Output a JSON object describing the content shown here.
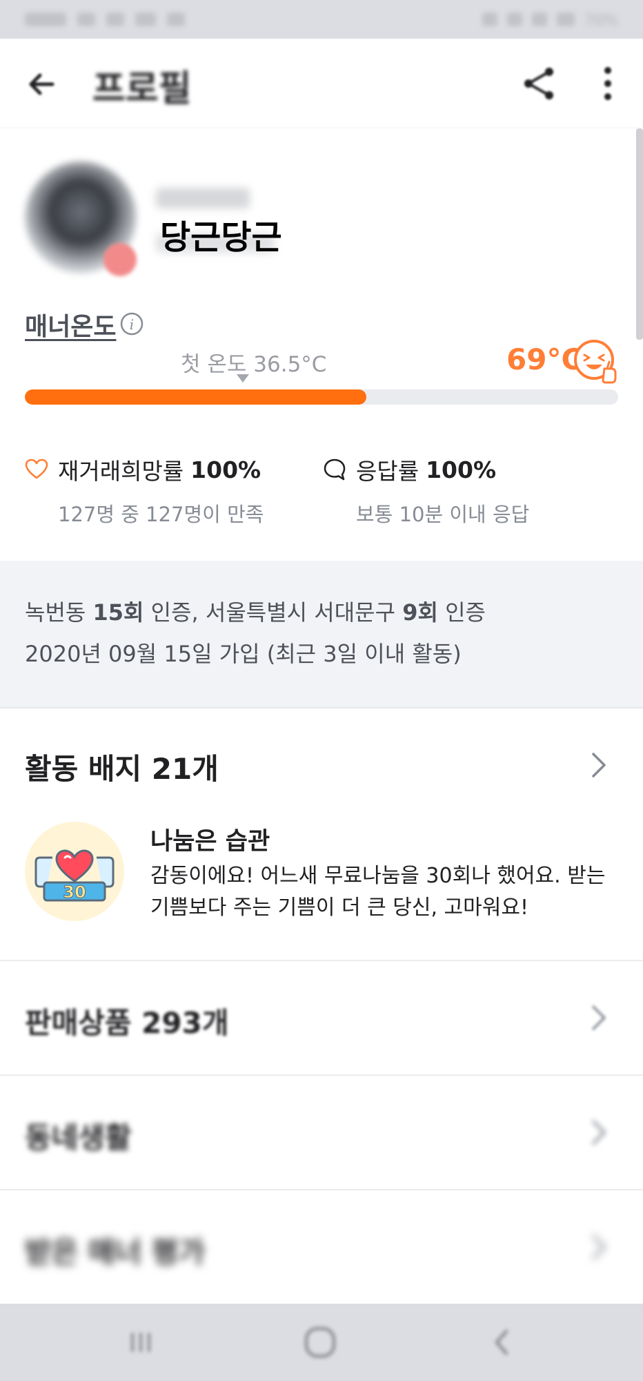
{
  "status_bar": {
    "right_text": "70%"
  },
  "app_bar": {
    "title": "프로필"
  },
  "profile": {
    "nickname": "당근당근"
  },
  "manner": {
    "label": "매너온도",
    "first_temp_label": "첫 온도 36.5°C",
    "temperature_label": "69°C",
    "temperature_value": 69,
    "progress_fraction": 0.576
  },
  "stats": {
    "retrade": {
      "label": "재거래희망률",
      "value": "100%",
      "sub": "127명 중 127명이 만족"
    },
    "response": {
      "label": "응답률",
      "value": "100%",
      "sub": "보통 10분 이내 응답"
    }
  },
  "certification": {
    "line1_a": "녹번동 ",
    "line1_b": "15회",
    "line1_c": " 인증, 서울특별시 서대문구 ",
    "line1_d": "9회",
    "line1_e": " 인증",
    "line2": "2020년 09월 15일 가입 (최근 3일 이내 활동)"
  },
  "badges": {
    "header": "활동 배지 21개",
    "badge_number": "30",
    "badge_name": "나눔은 습관",
    "badge_desc": "감동이에요! 어느새 무료나눔을 30회나 했어요. 받는 기쁨보다 주는 기쁨이 더 큰 당신, 고마워요!"
  },
  "sections": {
    "sales": "판매상품 293개",
    "neighborhood": "동네생활",
    "manner_reviews": "받은 매너 평가"
  },
  "colors": {
    "accent": "#ff6f0f",
    "temp_text": "#ff7e36",
    "cert_bg": "#f2f3f6"
  }
}
